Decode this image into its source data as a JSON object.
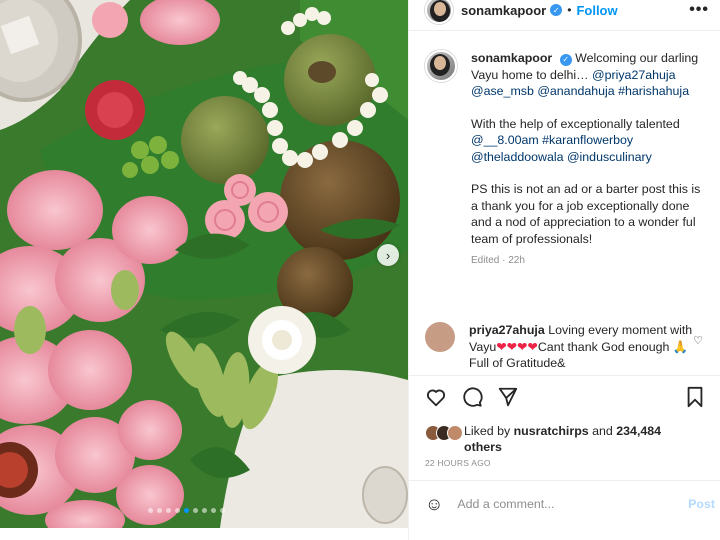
{
  "post": {
    "username": "sonamkapoor",
    "follow_label": "Follow",
    "bullet": "•",
    "more_label": "•••"
  },
  "caption": {
    "username": "sonamkapoor",
    "line1": "Welcoming our darling Vayu home to delhi…",
    "mentions1": [
      "@priya27ahuja",
      "@ase_msb",
      "@anandahuja",
      "#harishahuja"
    ],
    "para2_text": "With the help of exceptionally talented",
    "mentions2": [
      "@__8.00am",
      "#karanflowerboy",
      "@theladdoowala",
      "@indusculinary"
    ],
    "para3": "PS this is not an ad or a barter post this is a thank you for a job exceptionally done and a nod of appreciation to a wonder ful team of professionals!",
    "edited": "Edited · 22h"
  },
  "comment": {
    "username": "priya27ahuja",
    "text_a": "Loving every moment with Vayu",
    "hearts": "❤❤❤❤",
    "text_b": "Cant thank God enough 🙏 Full of Gratitude&"
  },
  "likes": {
    "prefix": "Liked by",
    "user": "nusratchirps",
    "and": "and",
    "count": "234,484",
    "suffix": "others"
  },
  "timestamp": "22 HOURS AGO",
  "add_comment": {
    "placeholder": "Add a comment...",
    "post_label": "Post"
  },
  "carousel": {
    "dot_count": 9,
    "active_index": 4
  },
  "colors": {
    "accent": "#0095f6",
    "link": "#00376b",
    "muted": "#8e8e8e",
    "heart_red": "#ed2244"
  }
}
